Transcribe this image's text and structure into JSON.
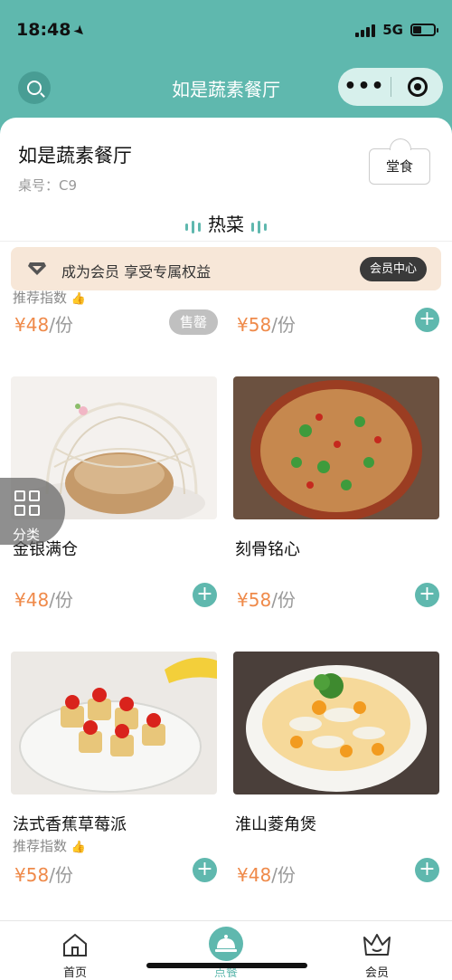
{
  "status": {
    "time": "18:48",
    "network": "5G"
  },
  "nav": {
    "title": "如是蔬素餐厅",
    "more_icon": "more-dots-icon",
    "close_icon": "target-close-icon"
  },
  "store": {
    "name": "如是蔬素餐厅",
    "table_label": "桌号：C9",
    "dine_mode": "堂食"
  },
  "category": {
    "current": "热菜"
  },
  "member_banner": {
    "text": "成为会员 享受专属权益",
    "button": "会员中心"
  },
  "partial_row": {
    "left": {
      "rec_label": "推荐指数",
      "price": "¥48",
      "unit": "/份",
      "soldout": "售罄"
    },
    "right": {
      "price": "¥58",
      "unit": "/份"
    }
  },
  "dishes": [
    {
      "name": "金银满仓",
      "price": "¥48",
      "unit": "/份",
      "rec_label": ""
    },
    {
      "name": "刻骨铭心",
      "price": "¥58",
      "unit": "/份",
      "rec_label": ""
    },
    {
      "name": "法式香蕉草莓派",
      "price": "¥58",
      "unit": "/份",
      "rec_label": "推荐指数"
    },
    {
      "name": "淮山菱角煲",
      "price": "¥48",
      "unit": "/份",
      "rec_label": ""
    }
  ],
  "float_category": {
    "label": "分类"
  },
  "tabbar": {
    "items": [
      {
        "label": "首页"
      },
      {
        "label": "点餐"
      },
      {
        "label": "会员"
      }
    ]
  },
  "colors": {
    "primary": "#5fb8ae",
    "price": "#ef8a4a",
    "banner": "#f7e7d8"
  }
}
